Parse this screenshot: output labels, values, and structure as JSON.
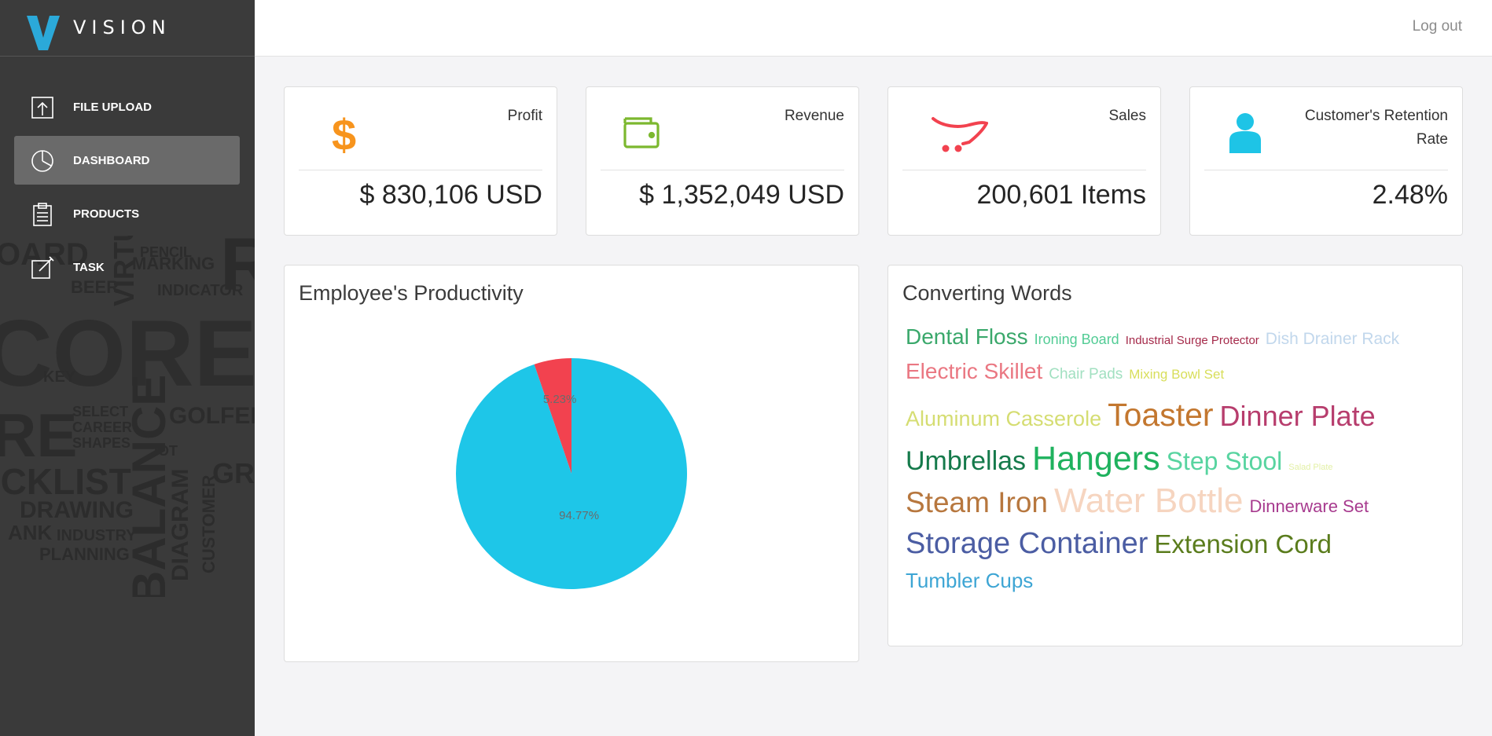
{
  "brand": {
    "name": "VISION",
    "logo_color": "#2ba9d9"
  },
  "sidebar": {
    "items": [
      {
        "label": "FILE UPLOAD",
        "icon": "upload-icon",
        "active": false
      },
      {
        "label": "DASHBOARD",
        "icon": "pie-chart-icon",
        "active": true
      },
      {
        "label": "PRODUCTS",
        "icon": "clipboard-icon",
        "active": false
      },
      {
        "label": "TASK",
        "icon": "edit-icon",
        "active": false
      }
    ]
  },
  "topbar": {
    "logout_label": "Log out"
  },
  "stats": [
    {
      "title": "Profit",
      "value": "$ 830,106 USD",
      "icon": "dollar-icon",
      "color": "#f7941d"
    },
    {
      "title": "Revenue",
      "value": "$ 1,352,049 USD",
      "icon": "wallet-icon",
      "color": "#7cb82f"
    },
    {
      "title": "Sales",
      "value": "200,601 Items",
      "icon": "cart-icon",
      "color": "#f2424f"
    },
    {
      "title": "Customer's Retention Rate",
      "value": "2.48%",
      "icon": "user-icon",
      "color": "#1ec4e6"
    }
  ],
  "productivity": {
    "title": "Employee's Productivity",
    "chart_data": {
      "type": "pie",
      "slices": [
        {
          "label": "5.23%",
          "value": 5.23,
          "color": "#f2424f"
        },
        {
          "label": "94.77%",
          "value": 94.77,
          "color": "#1ec6e8"
        }
      ]
    }
  },
  "words": {
    "title": "Converting Words",
    "lines": [
      [
        {
          "text": "Dental Floss",
          "size": 28,
          "color": "#3aa86b"
        },
        {
          "text": "Ironing Board",
          "size": 18,
          "color": "#52cc95"
        },
        {
          "text": "Industrial Surge Protector",
          "size": 15,
          "color": "#a52a4a"
        },
        {
          "text": "Dish Drainer Rack",
          "size": 21,
          "color": "#c1d7ec"
        }
      ],
      [
        {
          "text": "Electric Skillet",
          "size": 28,
          "color": "#ea7782"
        },
        {
          "text": "Chair Pads",
          "size": 19,
          "color": "#a2e0c1"
        },
        {
          "text": "Mixing Bowl Set",
          "size": 17,
          "color": "#d8de5a"
        }
      ],
      [
        {
          "text": "Aluminum Casserole",
          "size": 27,
          "color": "#d5dd72"
        },
        {
          "text": "Toaster",
          "size": 41,
          "color": "#c3772f"
        },
        {
          "text": "Dinner Plate",
          "size": 36,
          "color": "#b73d6d"
        }
      ],
      [
        {
          "text": "Umbrellas",
          "size": 34,
          "color": "#157a4b"
        },
        {
          "text": "Hangers",
          "size": 43,
          "color": "#1fb25e"
        },
        {
          "text": "Step Stool",
          "size": 32,
          "color": "#58d4a0"
        },
        {
          "text": "Salad Plate",
          "size": 11,
          "color": "#e3f0a6"
        }
      ],
      [
        {
          "text": "Steam Iron",
          "size": 37,
          "color": "#b7773e"
        },
        {
          "text": "Water Bottle",
          "size": 44,
          "color": "#f6d5c0"
        },
        {
          "text": "Dinnerware Set",
          "size": 22,
          "color": "#a73a8e"
        }
      ],
      [
        {
          "text": "Storage Container",
          "size": 38,
          "color": "#4b5da3"
        },
        {
          "text": "Extension Cord",
          "size": 33,
          "color": "#5a7c1c"
        }
      ],
      [
        {
          "text": "Tumbler Cups",
          "size": 26,
          "color": "#3da5d4"
        }
      ]
    ]
  }
}
